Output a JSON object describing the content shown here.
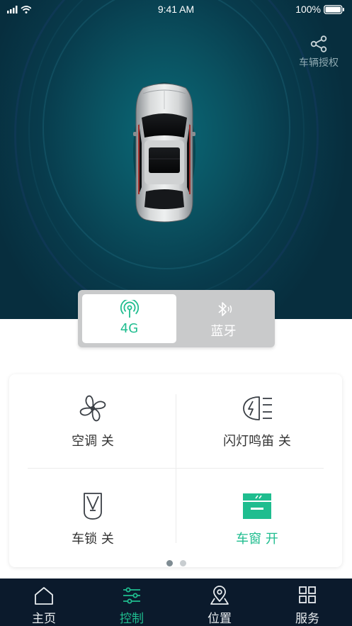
{
  "status_bar": {
    "time": "9:41 AM",
    "battery": "100%"
  },
  "header": {
    "share_label": "车辆授权",
    "share_icon": "share-icon"
  },
  "mode_toggle": {
    "options": [
      {
        "label": "4G",
        "icon": "cellular-antenna-icon",
        "selected": true
      },
      {
        "label": "蓝牙",
        "icon": "bluetooth-icon",
        "selected": false
      }
    ]
  },
  "controls": [
    {
      "label": "空调 关",
      "icon": "fan-icon",
      "active": false
    },
    {
      "label": "闪灯鸣笛 关",
      "icon": "headlight-horn-icon",
      "active": false
    },
    {
      "label": "车锁 关",
      "icon": "car-lock-icon",
      "active": false
    },
    {
      "label": "车窗 开",
      "icon": "window-icon",
      "active": true
    }
  ],
  "pager": {
    "pages": 2,
    "current": 1
  },
  "tabbar": {
    "tabs": [
      {
        "label": "主页",
        "icon": "home-icon"
      },
      {
        "label": "控制",
        "icon": "sliders-icon",
        "selected": true
      },
      {
        "label": "位置",
        "icon": "location-pin-icon"
      },
      {
        "label": "服务",
        "icon": "grid-icon"
      }
    ]
  },
  "colors": {
    "accent": "#1fbd8f",
    "hero_dark": "#072e3e",
    "tabbar_bg": "#0b1a2c"
  }
}
